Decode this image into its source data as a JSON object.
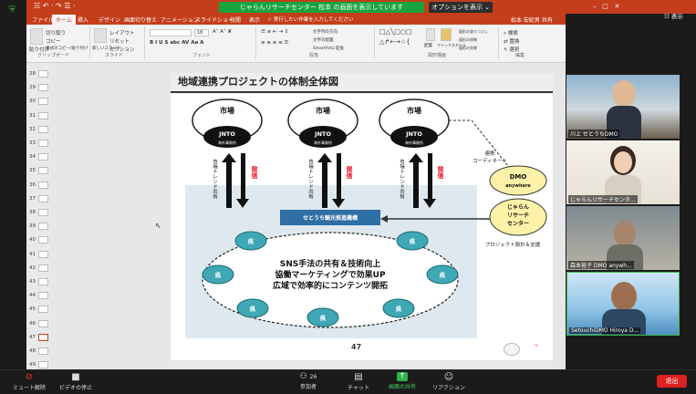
{
  "titlebar": {
    "quick_access": "☵ ↶ · ↷ ☰ ·",
    "share_banner": "じゃらんリサーチセンター 松本 の画面を表示しています",
    "share_options": "オプションを表示 ⌄",
    "view_label": "表示"
  },
  "ribbon": {
    "tabs": [
      "ファイル",
      "ホーム",
      "挿入",
      "デザイン",
      "画面切り替え",
      "アニメーション",
      "スライドショー",
      "校閲",
      "表示"
    ],
    "search": "実行したい作業を入力してください",
    "user": "松本 宏紀男  共有",
    "clipboard": {
      "paste": "貼り付け",
      "cut": "切り取り",
      "copy": "コピー",
      "format": "書式のコピー/貼り付け",
      "group": "クリップボード"
    },
    "slides": {
      "new": "新しいスライド",
      "layout": "レイアウト",
      "reset": "リセット",
      "section": "セクション",
      "group": "スライド"
    },
    "font": {
      "size": "18",
      "group": "フォント"
    },
    "paragraph": {
      "dir": "文字列の方向",
      "align": "文字の配置",
      "smartart": "SmartArtに変換",
      "group": "段落"
    },
    "drawing": {
      "arrange": "配置",
      "quick": "クイックスタイル",
      "fill": "図形の塗りつぶし",
      "outline": "図形の枠線",
      "effect": "図形の効果",
      "group": "図形描画"
    },
    "editing": {
      "find": "検索",
      "replace": "置換",
      "select": "選択",
      "group": "編集"
    }
  },
  "slide_numbers": [
    "28",
    "29",
    "30",
    "31",
    "32",
    "33",
    "34",
    "35",
    "36",
    "37",
    "38",
    "39",
    "40",
    "41",
    "42",
    "43",
    "44",
    "45",
    "46",
    "47",
    "48",
    "49"
  ],
  "slide": {
    "title": "地域連携プロジェクトの体制全体図",
    "market": "市場",
    "jnto": "JNTO",
    "overseas": "海外事務所",
    "trend_share": "市場トレンド共有",
    "send": "発信",
    "coord": "連携\nコーディネート",
    "dmo": "DMO",
    "anywhere": "anywhere",
    "jalan": "じゃらん",
    "research": "リサーチ",
    "center": "センター",
    "design_support": "プロジェクト設計＆支援",
    "setouchi_org": "せとうち観光推進機構",
    "pref": "県",
    "line1": "SNS手法の共有＆技術向上",
    "line2": "協働マーケティングで効果UP",
    "line3": "広域で効率的にコンテンツ開拓",
    "page": "47"
  },
  "participants": [
    {
      "name": "川上 せとうちDMO"
    },
    {
      "name": "じゃらんリサーチセンタ..."
    },
    {
      "name": "森本裕子 DMO anywh..."
    },
    {
      "name": "SetouchiDMO  Hiroya D..."
    }
  ],
  "toolbar": {
    "mute": "ミュート解除",
    "video": "ビデオの停止",
    "participants": "参加者",
    "participants_count": "26",
    "chat": "チャット",
    "share": "画面の共有",
    "reaction": "リアクション",
    "end": "退出"
  }
}
